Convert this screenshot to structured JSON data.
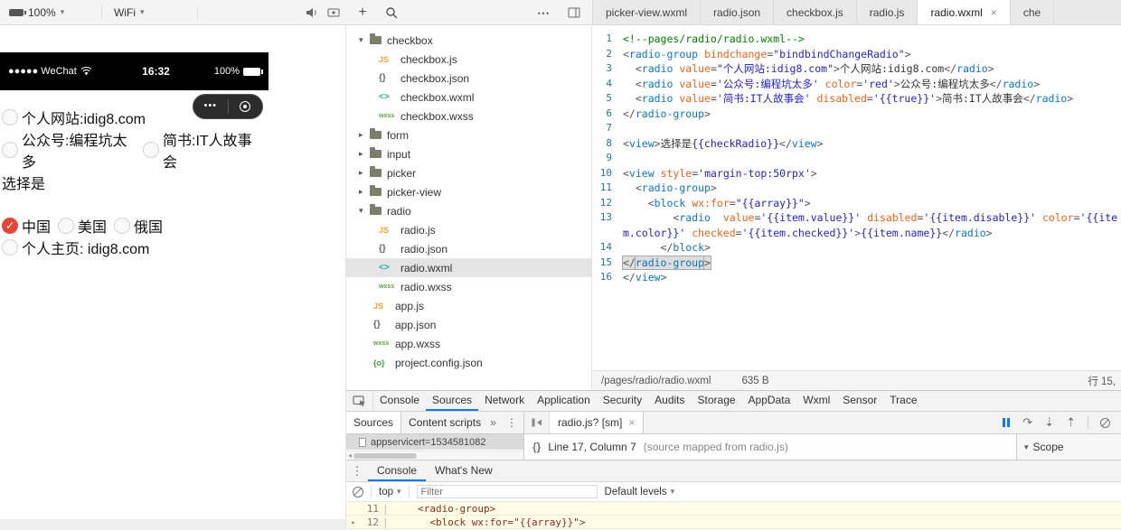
{
  "icons": {
    "add": "+",
    "more": "⋯"
  },
  "toolbar": {
    "battery_label": "100%",
    "network_label": "WiFi",
    "tabs": [
      {
        "label": "picker-view.wxml",
        "active": false
      },
      {
        "label": "radio.json",
        "active": false
      },
      {
        "label": "checkbox.js",
        "active": false
      },
      {
        "label": "radio.js",
        "active": false
      },
      {
        "label": "radio.wxml",
        "active": true
      },
      {
        "label": "che",
        "active": false
      }
    ]
  },
  "simulator": {
    "status_bar": {
      "carrier": "●●●●● WeChat",
      "time": "16:32",
      "battery": "100%"
    },
    "capsule_dots": "•••",
    "group1": [
      {
        "label": "个人网站:idig8.com",
        "checked": false
      },
      {
        "label": "公众号:编程坑太多",
        "checked": false
      },
      {
        "label": "简书:IT人故事会",
        "checked": false
      }
    ],
    "selection_text": "选择是",
    "group2": [
      {
        "label": "中国",
        "checked": true
      },
      {
        "label": "美国",
        "checked": false
      },
      {
        "label": "俄国",
        "checked": false
      },
      {
        "label": "个人主页: idig8.com",
        "checked": false
      }
    ]
  },
  "file_tree": [
    {
      "kind": "folder",
      "label": "checkbox",
      "expanded": true
    },
    {
      "kind": "js",
      "label": "checkbox.js"
    },
    {
      "kind": "json",
      "label": "checkbox.json"
    },
    {
      "kind": "wxml",
      "label": "checkbox.wxml"
    },
    {
      "kind": "wxss",
      "label": "checkbox.wxss"
    },
    {
      "kind": "folder",
      "label": "form",
      "expanded": false
    },
    {
      "kind": "folder",
      "label": "input",
      "expanded": false
    },
    {
      "kind": "folder",
      "label": "picker",
      "expanded": false
    },
    {
      "kind": "folder",
      "label": "picker-view",
      "expanded": false
    },
    {
      "kind": "folder",
      "label": "radio",
      "expanded": true
    },
    {
      "kind": "js",
      "label": "radio.js"
    },
    {
      "kind": "json",
      "label": "radio.json"
    },
    {
      "kind": "wxml",
      "label": "radio.wxml",
      "selected": true
    },
    {
      "kind": "wxss",
      "label": "radio.wxss"
    },
    {
      "kind": "js",
      "label": "app.js",
      "root": true
    },
    {
      "kind": "json",
      "label": "app.json",
      "root": true
    },
    {
      "kind": "wxss",
      "label": "app.wxss",
      "root": true
    },
    {
      "kind": "config",
      "label": "project.config.json",
      "root": true
    }
  ],
  "code": {
    "lines": [
      {
        "n": 1,
        "toks": [
          [
            "c",
            "<!--pages/radio/radio.wxml-->"
          ]
        ]
      },
      {
        "n": 2,
        "toks": [
          [
            "p",
            "<"
          ],
          [
            "t",
            "radio-group"
          ],
          [
            "p",
            " "
          ],
          [
            "a",
            "bindchange"
          ],
          [
            "p",
            "="
          ],
          [
            "s",
            "\"bindbindChangeRadio\""
          ],
          [
            "p",
            ">"
          ]
        ]
      },
      {
        "n": 3,
        "toks": [
          [
            "p",
            "  <"
          ],
          [
            "t",
            "radio"
          ],
          [
            "p",
            " "
          ],
          [
            "a",
            "value"
          ],
          [
            "p",
            "="
          ],
          [
            "s",
            "\"个人网站:idig8.com\""
          ],
          [
            "p",
            ">"
          ],
          [
            "x",
            "个人网站:idig8.com"
          ],
          [
            "p",
            "</"
          ],
          [
            "t",
            "radio"
          ],
          [
            "p",
            ">"
          ]
        ]
      },
      {
        "n": 4,
        "toks": [
          [
            "p",
            "  <"
          ],
          [
            "t",
            "radio"
          ],
          [
            "p",
            " "
          ],
          [
            "a",
            "value"
          ],
          [
            "p",
            "="
          ],
          [
            "s",
            "'公众号:编程坑太多'"
          ],
          [
            "p",
            " "
          ],
          [
            "a",
            "color"
          ],
          [
            "p",
            "="
          ],
          [
            "s",
            "'red'"
          ],
          [
            "p",
            ">"
          ],
          [
            "x",
            "公众号:编程坑太多"
          ],
          [
            "p",
            "</"
          ],
          [
            "t",
            "radio"
          ],
          [
            "p",
            ">"
          ]
        ]
      },
      {
        "n": 5,
        "toks": [
          [
            "p",
            "  <"
          ],
          [
            "t",
            "radio"
          ],
          [
            "p",
            " "
          ],
          [
            "a",
            "value"
          ],
          [
            "p",
            "="
          ],
          [
            "s",
            "'简书:IT人故事会'"
          ],
          [
            "p",
            " "
          ],
          [
            "a",
            "disabled"
          ],
          [
            "p",
            "="
          ],
          [
            "s",
            "'{{true}}'"
          ],
          [
            "p",
            ">"
          ],
          [
            "x",
            "简书:IT人故事会"
          ],
          [
            "p",
            "</"
          ],
          [
            "t",
            "radio"
          ],
          [
            "p",
            ">"
          ]
        ]
      },
      {
        "n": 6,
        "toks": [
          [
            "p",
            "</"
          ],
          [
            "t",
            "radio-group"
          ],
          [
            "p",
            ">"
          ]
        ]
      },
      {
        "n": 7,
        "toks": []
      },
      {
        "n": 8,
        "toks": [
          [
            "p",
            "<"
          ],
          [
            "t",
            "view"
          ],
          [
            "p",
            ">"
          ],
          [
            "x",
            "选择是"
          ],
          [
            "m",
            "{{checkRadio}}"
          ],
          [
            "p",
            "</"
          ],
          [
            "t",
            "view"
          ],
          [
            "p",
            ">"
          ]
        ]
      },
      {
        "n": 9,
        "toks": []
      },
      {
        "n": 10,
        "toks": [
          [
            "p",
            "<"
          ],
          [
            "t",
            "view"
          ],
          [
            "p",
            " "
          ],
          [
            "a",
            "style"
          ],
          [
            "p",
            "="
          ],
          [
            "s",
            "'margin-top:50rpx'"
          ],
          [
            "p",
            ">"
          ]
        ]
      },
      {
        "n": 11,
        "toks": [
          [
            "p",
            "  <"
          ],
          [
            "t",
            "radio-group"
          ],
          [
            "p",
            ">"
          ]
        ]
      },
      {
        "n": 12,
        "toks": [
          [
            "p",
            "    <"
          ],
          [
            "t",
            "block"
          ],
          [
            "p",
            " "
          ],
          [
            "a",
            "wx:for"
          ],
          [
            "p",
            "="
          ],
          [
            "s",
            "\"{{array}}\""
          ],
          [
            "p",
            ">"
          ]
        ]
      },
      {
        "n": 13,
        "toks": [
          [
            "p",
            "        <"
          ],
          [
            "t",
            "radio"
          ],
          [
            "p",
            "  "
          ],
          [
            "a",
            "value"
          ],
          [
            "p",
            "="
          ],
          [
            "s",
            "'{{item.value}}'"
          ],
          [
            "p",
            " "
          ],
          [
            "a",
            "disabled"
          ],
          [
            "p",
            "="
          ],
          [
            "s",
            "'{{item.disable}}'"
          ],
          [
            "p",
            " "
          ],
          [
            "a",
            "color"
          ],
          [
            "p",
            "="
          ],
          [
            "s",
            "'{{item.color}}'"
          ],
          [
            "p",
            " "
          ],
          [
            "a",
            "checked"
          ],
          [
            "p",
            "="
          ],
          [
            "s",
            "'{{item.checked}}'"
          ],
          [
            "p",
            ">"
          ],
          [
            "m",
            "{{item.name}}"
          ],
          [
            "p",
            "</"
          ],
          [
            "t",
            "radio"
          ],
          [
            "p",
            ">"
          ]
        ]
      },
      {
        "n": 14,
        "toks": [
          [
            "p",
            "      </"
          ],
          [
            "t",
            "block"
          ],
          [
            "p",
            ">"
          ]
        ]
      },
      {
        "n": 15,
        "toks": [
          [
            "p",
            "</",
            true
          ],
          [
            "t",
            "radio-group",
            true
          ],
          [
            "p",
            ">",
            true
          ]
        ]
      },
      {
        "n": 16,
        "toks": [
          [
            "p",
            "</"
          ],
          [
            "t",
            "view"
          ],
          [
            "p",
            ">"
          ]
        ]
      }
    ]
  },
  "editor_status": {
    "path": "/pages/radio/radio.wxml",
    "size": "635 B",
    "cursor": "行 15,"
  },
  "devtools": {
    "tabs": [
      "Console",
      "Sources",
      "Network",
      "Application",
      "Security",
      "Audits",
      "Storage",
      "AppData",
      "Wxml",
      "Sensor",
      "Trace"
    ],
    "active_tab": "Sources",
    "navigator": {
      "subtabs": [
        "Sources",
        "Content scripts"
      ],
      "active_subtab": "Sources",
      "selected_item": "appservicert=1534581082"
    },
    "editor": {
      "file_tab": "radio.js? [sm]",
      "brace_icon": "{}",
      "cursor_info": "Line 17, Column 7",
      "mapped_info": "(source mapped from radio.js)",
      "scope_label": "Scope"
    },
    "console": {
      "tabs": [
        "Console",
        "What's New"
      ],
      "active_tab": "Console",
      "context_label": "top",
      "filter_placeholder": "Filter",
      "levels_label": "Default levels",
      "messages": [
        {
          "expand": false,
          "line": "11",
          "text": "    <radio-group>"
        },
        {
          "expand": true,
          "line": "12",
          "text": "      <block wx:for=\"{{array}}\">"
        }
      ]
    }
  }
}
